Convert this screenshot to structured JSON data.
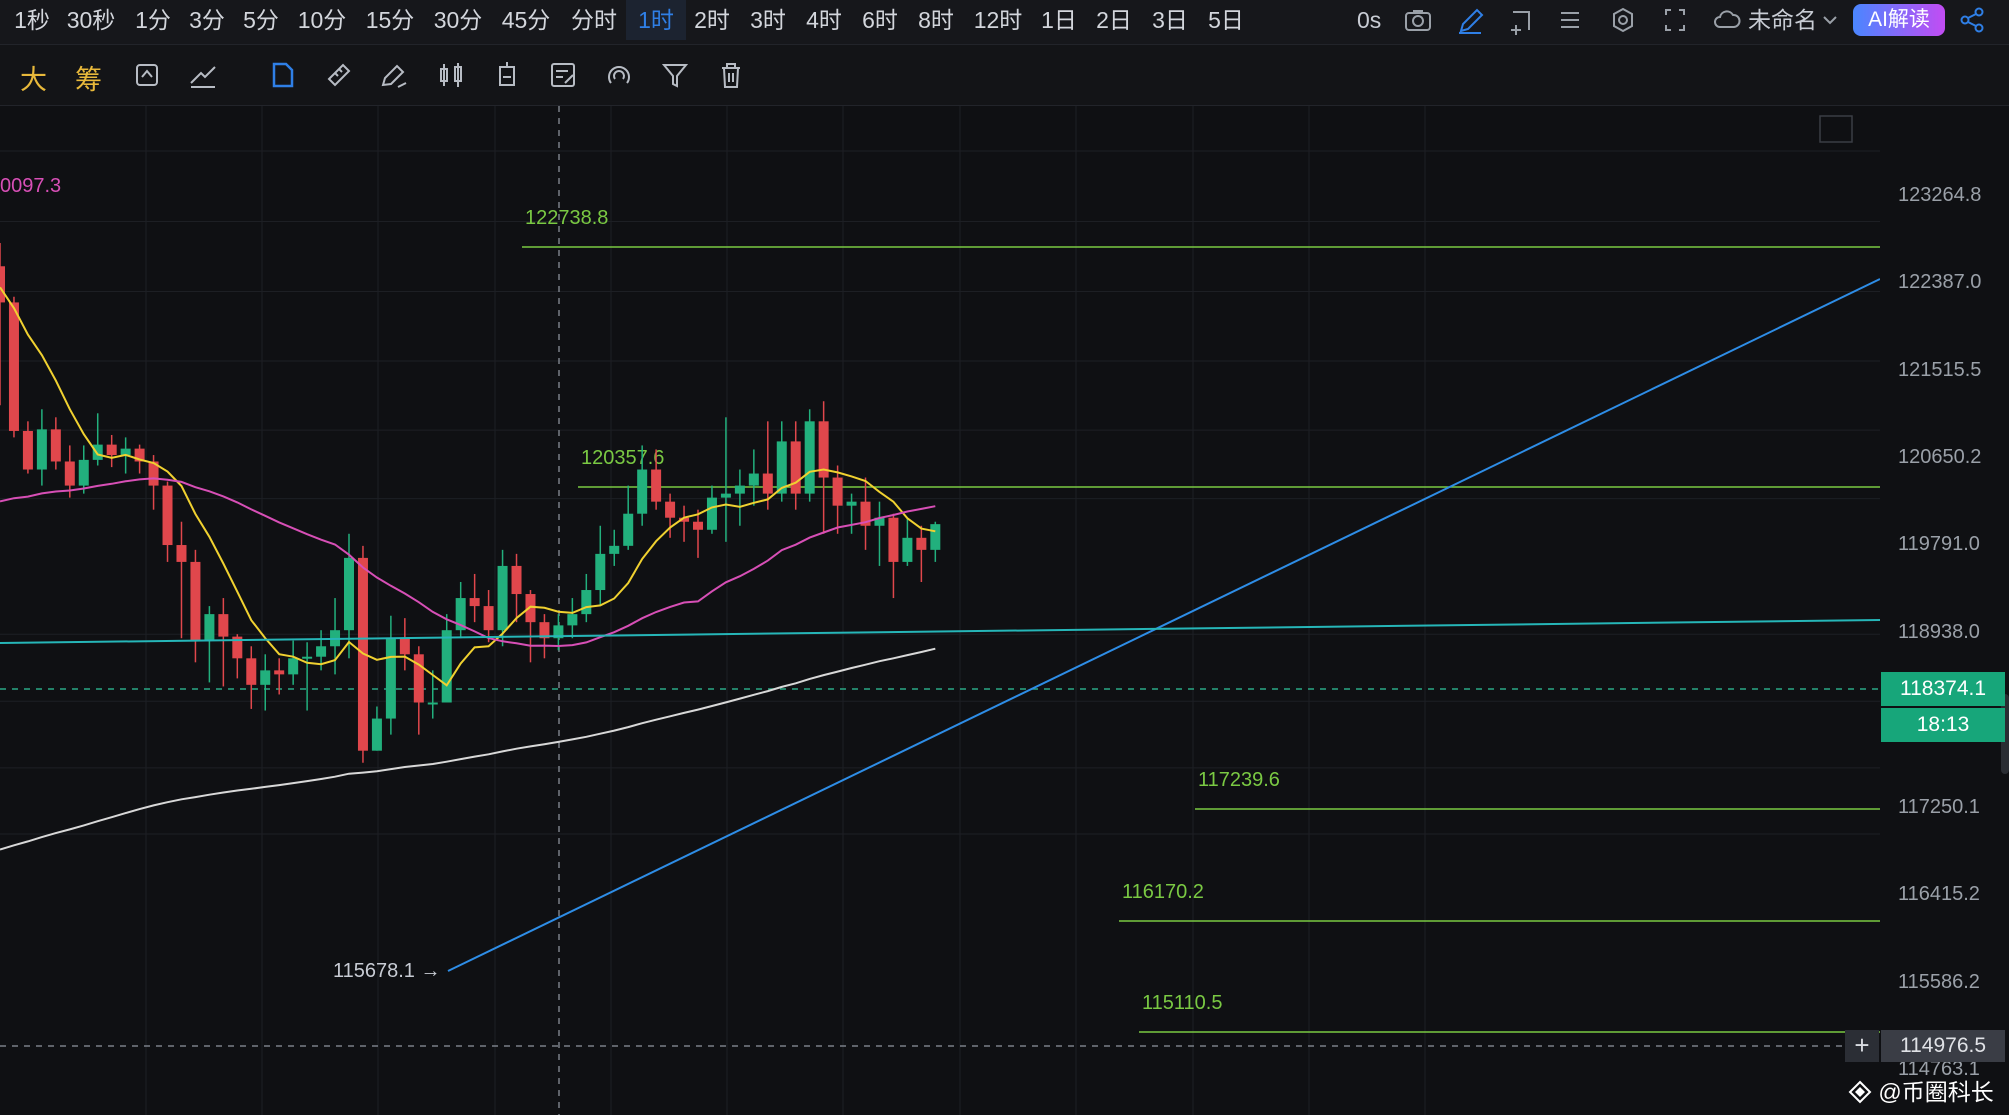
{
  "timeframes": [
    {
      "label": "1秒"
    },
    {
      "label": "30秒"
    },
    {
      "label": "1分"
    },
    {
      "label": "3分"
    },
    {
      "label": "5分"
    },
    {
      "label": "10分"
    },
    {
      "label": "15分"
    },
    {
      "label": "30分"
    },
    {
      "label": "45分"
    },
    {
      "label": "分时"
    },
    {
      "label": "1时",
      "active": true
    },
    {
      "label": "2时"
    },
    {
      "label": "3时"
    },
    {
      "label": "4时"
    },
    {
      "label": "6时"
    },
    {
      "label": "8时"
    },
    {
      "label": "12时"
    },
    {
      "label": "1日"
    },
    {
      "label": "2日"
    },
    {
      "label": "3日"
    },
    {
      "label": "5日"
    }
  ],
  "topbar": {
    "delay": "0s",
    "layout_name": "未命名",
    "ai_button": "AI解读"
  },
  "toolbar": {
    "text_tool_1": "大",
    "text_tool_2": "筹"
  },
  "axis": {
    "labels": [
      "123264.8",
      "122387.0",
      "121515.5",
      "120650.2",
      "119791.0",
      "118938.0",
      "117250.1",
      "116415.2",
      "115586.2",
      "114763.1"
    ]
  },
  "price_levels": [
    "122738.8",
    "120357.6",
    "117239.6",
    "116170.2",
    "115110.5"
  ],
  "annotations": {
    "low_label": "115678.1",
    "left_edge_value": "0097.3"
  },
  "current_price": "118374.1",
  "countdown": "18:13",
  "crosshair_price": "114976.5",
  "watermark": "@币圈科长",
  "colors": {
    "up": "#22b07d",
    "down": "#e0474c",
    "ma_yellow": "#f0d130",
    "ma_pink": "#d74fb6",
    "ma_white": "#d8d8d8",
    "trend_blue": "#2e8de6",
    "trend_cyan": "#26b6b8",
    "level_green": "#7ac943"
  }
}
